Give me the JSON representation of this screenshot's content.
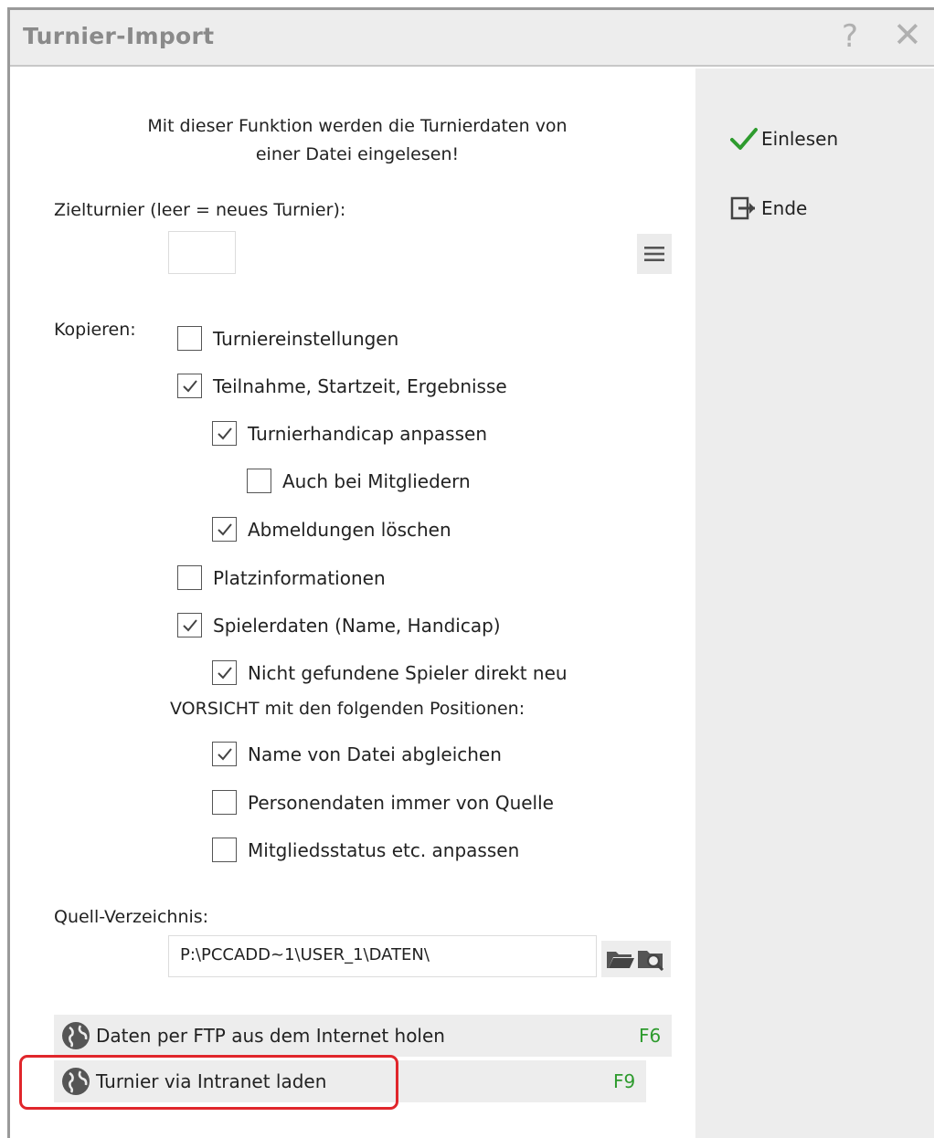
{
  "window": {
    "title": "Turnier-Import",
    "help_symbol": "?",
    "close_symbol": "✕"
  },
  "sidebar": {
    "einlesen_label": "Einlesen",
    "ende_label": "Ende"
  },
  "intro": {
    "line1": "Mit dieser Funktion werden die Turnierdaten von",
    "line2": "einer Datei eingelesen!"
  },
  "zielturnier": {
    "label": "Zielturnier (leer = neues Turnier):",
    "value": ""
  },
  "kopieren": {
    "label": "Kopieren:",
    "options": [
      {
        "label": "Turniereinstellungen",
        "checked": false
      },
      {
        "label": "Teilnahme, Startzeit, Ergebnisse",
        "checked": true
      },
      {
        "label": "Turnierhandicap anpassen",
        "checked": true
      },
      {
        "label": "Auch bei Mitgliedern",
        "checked": false
      },
      {
        "label": "Abmeldungen löschen",
        "checked": true
      },
      {
        "label": "Platzinformationen",
        "checked": false
      },
      {
        "label": "Spielerdaten (Name, Handicap)",
        "checked": true
      },
      {
        "label": "Nicht gefundene Spieler direkt neu",
        "checked": true
      },
      {
        "label": "Name von Datei abgleichen",
        "checked": true
      },
      {
        "label": "Personendaten immer von Quelle",
        "checked": false
      },
      {
        "label": "Mitgliedsstatus etc. anpassen",
        "checked": false
      }
    ]
  },
  "vorsicht_text": "VORSICHT mit den folgenden Positionen:",
  "quell": {
    "label": "Quell-Verzeichnis:",
    "path": "P:\\PCCADD~1\\USER_1\\DATEN\\"
  },
  "actions": {
    "ftp_label": "Daten per FTP aus dem Internet holen",
    "ftp_key": "F6",
    "intranet_label": "Turnier via Intranet laden",
    "intranet_key": "F9"
  },
  "colors": {
    "accent_green": "#2e9b2e",
    "highlight_red": "#e0262b",
    "sidebar_bg": "#ededed"
  }
}
